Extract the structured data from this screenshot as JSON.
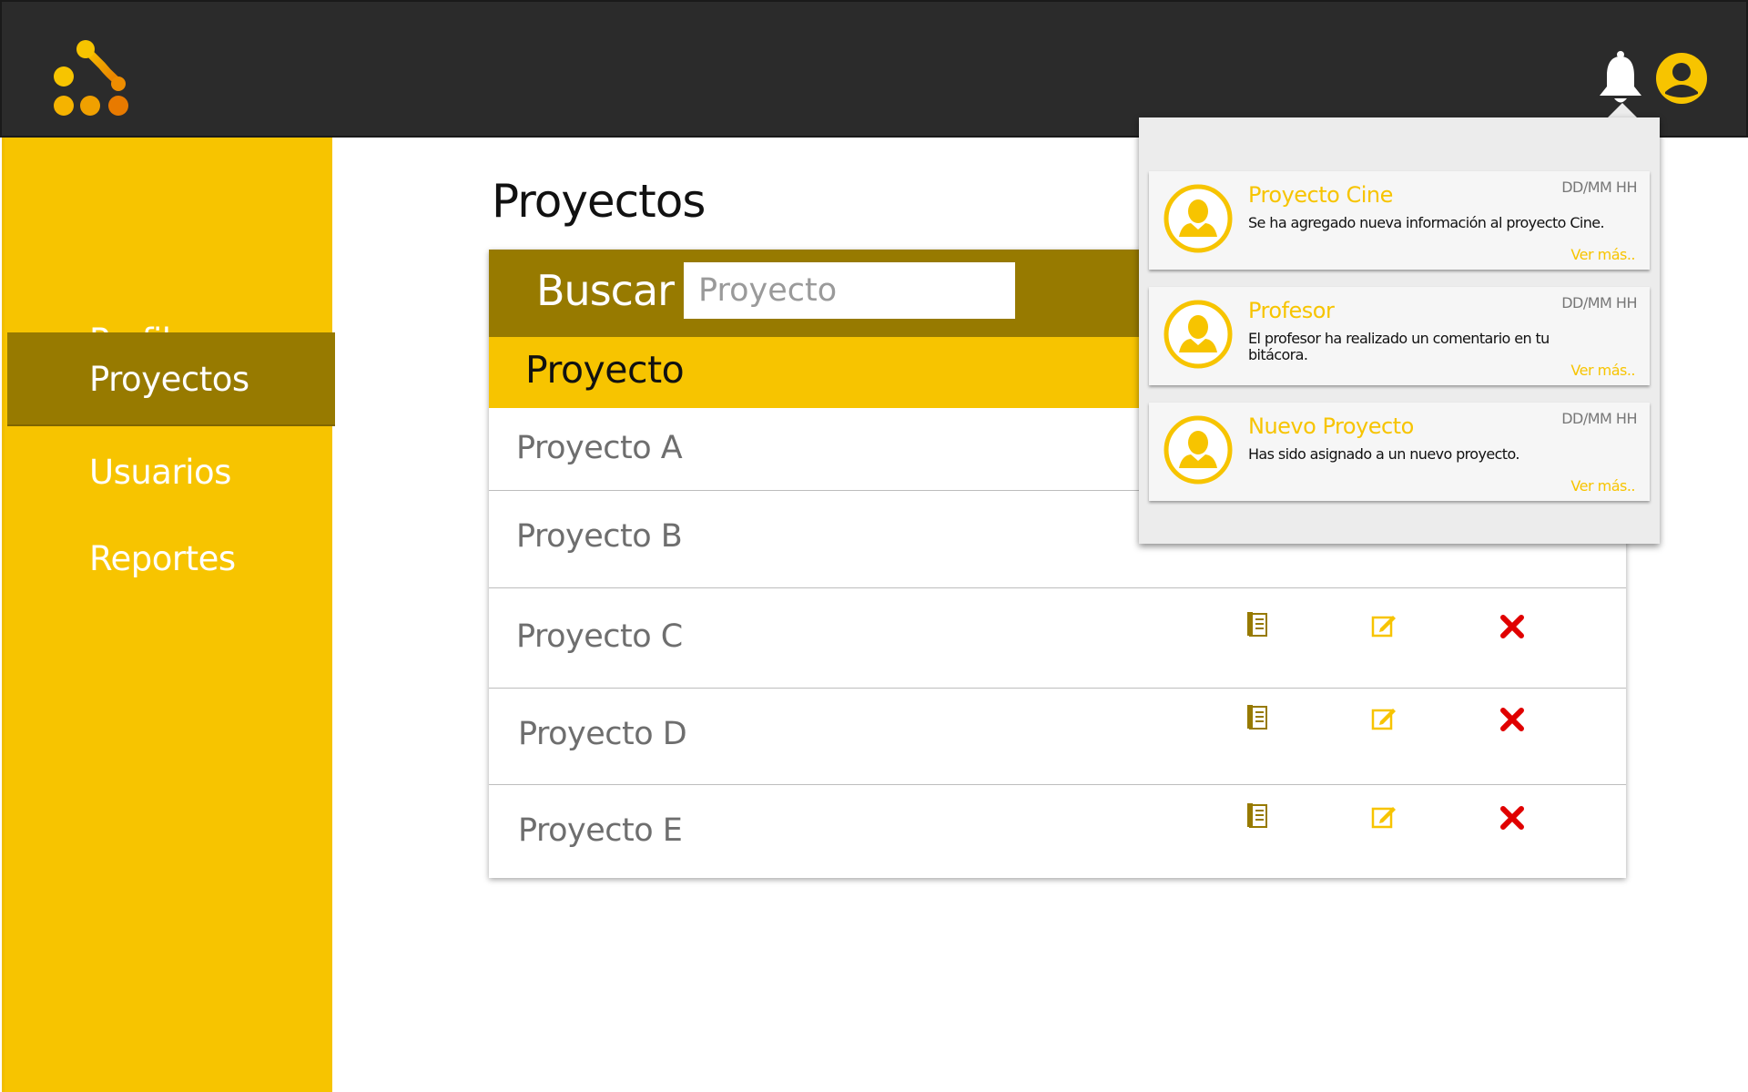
{
  "colors": {
    "topbar": "#2b2b2b",
    "accent_yellow": "#f7c400",
    "accent_olive": "#977a00",
    "delete_red": "#e00000"
  },
  "header": {
    "logo_icon": "dots-network-logo",
    "notification_icon": "bell-icon",
    "user_icon": "user-circle-icon"
  },
  "sidebar": {
    "items": [
      {
        "label": "Perfil",
        "active": false
      },
      {
        "label": "Proyectos",
        "active": true
      },
      {
        "label": "Usuarios",
        "active": false
      },
      {
        "label": "Reportes",
        "active": false
      }
    ]
  },
  "main": {
    "title": "Proyectos",
    "search": {
      "label": "Buscar",
      "placeholder": "Proyecto"
    },
    "table": {
      "column_header": "Proyecto",
      "rows": [
        {
          "name": "Proyecto A"
        },
        {
          "name": "Proyecto B"
        },
        {
          "name": "Proyecto C"
        },
        {
          "name": "Proyecto D"
        },
        {
          "name": "Proyecto E"
        }
      ],
      "actions": [
        "view-document-icon",
        "edit-icon",
        "delete-icon"
      ]
    }
  },
  "notifications": [
    {
      "title": "Proyecto Cine",
      "date": "DD/MM HH",
      "message": "Se ha agregado nueva información al proyecto Cine.",
      "more": "Ver más.."
    },
    {
      "title": "Profesor",
      "date": "DD/MM HH",
      "message": "El profesor ha realizado un comentario en tu bitácora.",
      "more": "Ver más.."
    },
    {
      "title": "Nuevo Proyecto",
      "date": "DD/MM HH",
      "message": "Has sido asignado a un nuevo proyecto.",
      "more": "Ver más.."
    }
  ]
}
